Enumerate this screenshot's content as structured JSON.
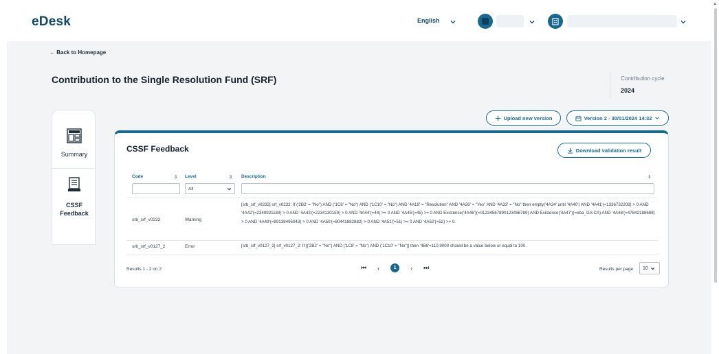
{
  "header": {
    "logo": "eDesk",
    "language": "English"
  },
  "nav": {
    "back_label": "← Back to Homepage"
  },
  "page": {
    "title": "Contribution to the Single Resolution Fund (SRF)",
    "cycle_label": "Contribution cycle",
    "cycle_value": "2024"
  },
  "actions": {
    "upload_label": "Upload new version",
    "version_label": "Version 2 - 30/01/2024 14:32"
  },
  "sidebar": {
    "items": [
      {
        "label": "Summary"
      },
      {
        "label": "CSSF Feedback"
      }
    ]
  },
  "card": {
    "title": "CSSF Feedback",
    "download_label": "Download validation result"
  },
  "table": {
    "columns": [
      "Code",
      "Level",
      "Description"
    ],
    "level_filter": "All",
    "rows": [
      {
        "code": "srb_srf_v0232",
        "level": "Warning",
        "description": "[srb_srf_v0232] srf_v0232: If ('2B2' = \"No\") AND ('1C8' = \"No\") AND ('1C10' = \"No\") AND '4A19' = \"Resolution\" AND '4A26' = \"Yes\" AND '4A33' = \"No\" then empty('4A34' until '4A40') AND '4A41'(=1336732208) > 0 AND '4A42'(=2349921189) > 0 AND '4A43'(=2234130159) > 0 AND '4A44'(=44) >= 0 AND '4A45'(=45) >= 0 AND Existence('4A46')(=0123456789012345678​9) AND Existence('4A47')(=eba_GA:CA) AND '4A48'(=47842188688) > 0 AND '4A49'(=89138495043) > 0 AND '4A50'(=80441882882) > 0 AND '4A51'(=51) >= 0 AND '4A52'(=52) >= 0."
      },
      {
        "code": "srb_srf_v0127_2",
        "level": "Error",
        "description": "[srb_srf_v0127_2] srf_v0127_2: If [('2B2' = \"No\") AND ('1C8' = \"No\") AND ('1C10' = \"No\")] then '4B6'=110.9000 should be a value below or equal to 100."
      }
    ]
  },
  "pagination": {
    "results_text": "Results 1 - 2 on 2",
    "current_page": "1",
    "rpp_label": "Results per page",
    "rpp_value": "10"
  },
  "colors": {
    "brand": "#17688f",
    "brand_dark": "#0f4b6b",
    "background": "#f2f4f6"
  }
}
